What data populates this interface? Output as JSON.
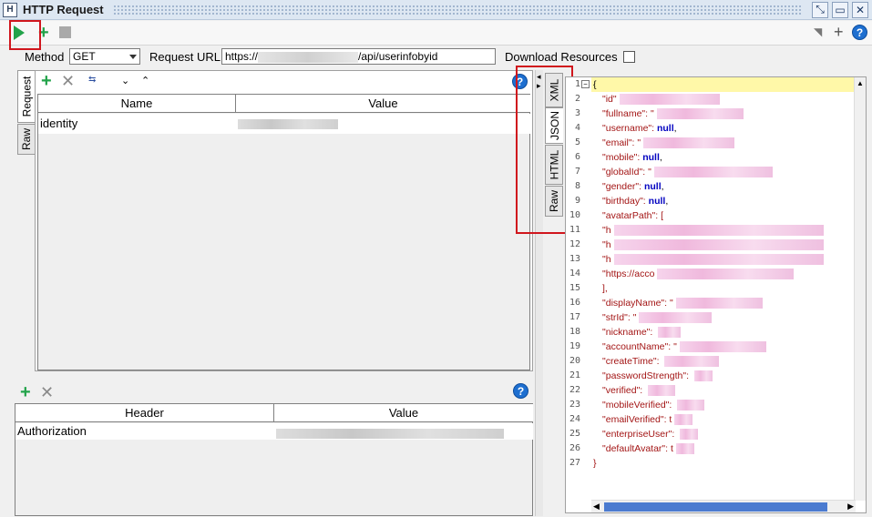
{
  "window": {
    "title": "HTTP Request"
  },
  "request": {
    "method_label": "Method",
    "method_value": "GET",
    "url_label": "Request URL:",
    "url_prefix": "https://",
    "url_suffix": "/api/userinfobyid",
    "download_label": "Download Resources"
  },
  "left_tabs": [
    "Request",
    "Raw"
  ],
  "params": {
    "headers": [
      "Name",
      "Value"
    ],
    "rows": [
      {
        "name": "identity",
        "value": ""
      }
    ]
  },
  "headers_table": {
    "headers": [
      "Header",
      "Value"
    ],
    "rows": [
      {
        "name": "Authorization",
        "value": ""
      }
    ]
  },
  "right_tabs": [
    "XML",
    "JSON",
    "HTML",
    "Raw"
  ],
  "json_lines": [
    {
      "n": "1",
      "segs": [
        [
          "p",
          "{"
        ]
      ]
    },
    {
      "n": "2",
      "segs": [
        [
          "key",
          "\"id\""
        ]
      ]
    },
    {
      "n": "3",
      "segs": [
        [
          "key",
          "\"fullname\": \""
        ]
      ]
    },
    {
      "n": "4",
      "segs": [
        [
          "key",
          "\"username\": "
        ],
        [
          "kw",
          "null"
        ],
        [
          "p",
          ","
        ]
      ]
    },
    {
      "n": "5",
      "segs": [
        [
          "key",
          "\"email\": \""
        ]
      ]
    },
    {
      "n": "6",
      "segs": [
        [
          "key",
          "\"mobile\": "
        ],
        [
          "kw",
          "null"
        ],
        [
          "p",
          ","
        ]
      ]
    },
    {
      "n": "7",
      "segs": [
        [
          "key",
          "\"globalId\": \""
        ]
      ]
    },
    {
      "n": "8",
      "segs": [
        [
          "key",
          "\"gender\": "
        ],
        [
          "kw",
          "null"
        ],
        [
          "p",
          ","
        ]
      ]
    },
    {
      "n": "9",
      "segs": [
        [
          "key",
          "\"birthday\": "
        ],
        [
          "kw",
          "null"
        ],
        [
          "p",
          ","
        ]
      ]
    },
    {
      "n": "10",
      "segs": [
        [
          "key",
          "\"avatarPath\": "
        ],
        [
          "key",
          "["
        ]
      ]
    },
    {
      "n": "11",
      "segs": [
        [
          "key",
          "  \"h"
        ]
      ]
    },
    {
      "n": "12",
      "segs": [
        [
          "key",
          "  \"h"
        ]
      ]
    },
    {
      "n": "13",
      "segs": [
        [
          "key",
          "  \"h"
        ]
      ]
    },
    {
      "n": "14",
      "segs": [
        [
          "key",
          "  \"https://acco"
        ]
      ]
    },
    {
      "n": "15",
      "segs": [
        [
          "key",
          "],"
        ]
      ]
    },
    {
      "n": "16",
      "segs": [
        [
          "key",
          "\"displayName\": \""
        ]
      ]
    },
    {
      "n": "17",
      "segs": [
        [
          "key",
          "\"strId\": \""
        ]
      ]
    },
    {
      "n": "18",
      "segs": [
        [
          "key",
          "\"nickname\": "
        ]
      ]
    },
    {
      "n": "19",
      "segs": [
        [
          "key",
          "\"accountName\": \""
        ]
      ]
    },
    {
      "n": "20",
      "segs": [
        [
          "key",
          "\"createTime\": "
        ]
      ]
    },
    {
      "n": "21",
      "segs": [
        [
          "key",
          "\"passwordStrength\": "
        ]
      ]
    },
    {
      "n": "22",
      "segs": [
        [
          "key",
          "\"verified\": "
        ]
      ]
    },
    {
      "n": "23",
      "segs": [
        [
          "key",
          "\"mobileVerified\": "
        ]
      ]
    },
    {
      "n": "24",
      "segs": [
        [
          "key",
          "\"emailVerified\": t"
        ]
      ]
    },
    {
      "n": "25",
      "segs": [
        [
          "key",
          "\"enterpriseUser\": "
        ]
      ]
    },
    {
      "n": "26",
      "segs": [
        [
          "key",
          "\"defaultAvatar\": t"
        ]
      ]
    },
    {
      "n": "27",
      "segs": [
        [
          "key",
          "}"
        ]
      ]
    }
  ],
  "colors": {
    "accent_green": "#22a34a",
    "highlight_red": "#d0161d",
    "json_key": "#a31515",
    "json_keyword": "#0000c0"
  }
}
